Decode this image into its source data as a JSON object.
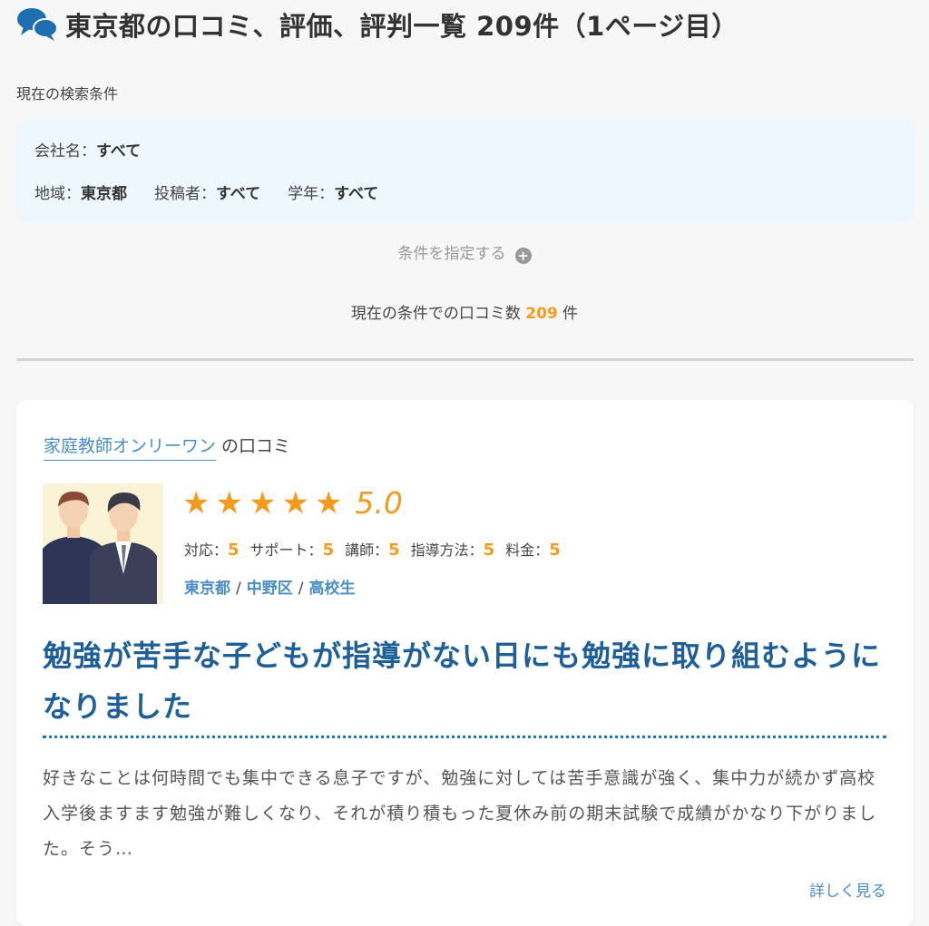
{
  "page_title": "東京都の口コミ、評価、評判一覧 209件（1ページ目）",
  "conditions": {
    "heading": "現在の検索条件",
    "company_label": "会社名：",
    "company_value": "すべて",
    "region_label": "地域：",
    "region_value": "東京都",
    "poster_label": "投稿者：",
    "poster_value": "すべて",
    "grade_label": "学年：",
    "grade_value": "すべて",
    "specify_label": "条件を指定する"
  },
  "count": {
    "prefix": "現在の条件での口コミ数",
    "value": "209",
    "suffix": "件"
  },
  "review": {
    "company_name": "家庭教師オンリーワン",
    "company_suffix": "の口コミ",
    "rating": 5.0,
    "score": "5.0",
    "sub_ratings": [
      {
        "label": "対応：",
        "value": "5"
      },
      {
        "label": "サポート：",
        "value": "5"
      },
      {
        "label": "講師：",
        "value": "5"
      },
      {
        "label": "指導方法：",
        "value": "5"
      },
      {
        "label": "料金：",
        "value": "5"
      }
    ],
    "tags": [
      "東京都",
      "中野区",
      "高校生"
    ],
    "title": "勉強が苦手な子どもが指導がない日にも勉強に取り組むようになりました",
    "body": "好きなことは何時間でも集中できる息子ですが、勉強に対しては苦手意識が強く、集中力が続かず高校入学後ますます勉強が難しくなり、それが積り積もった夏休み前の期末試験で成績がかなり下がりました。そう…",
    "more_label": "詳しく見る"
  },
  "colors": {
    "accent_orange": "#f39a1f",
    "link_blue": "#4a8ec8",
    "title_blue": "#1f5f98",
    "condition_bg": "#eef7fd"
  },
  "icons": {
    "title_icon": "speech-bubbles-icon",
    "plus_icon": "plus-circle-icon",
    "star_icon": "star-icon"
  }
}
